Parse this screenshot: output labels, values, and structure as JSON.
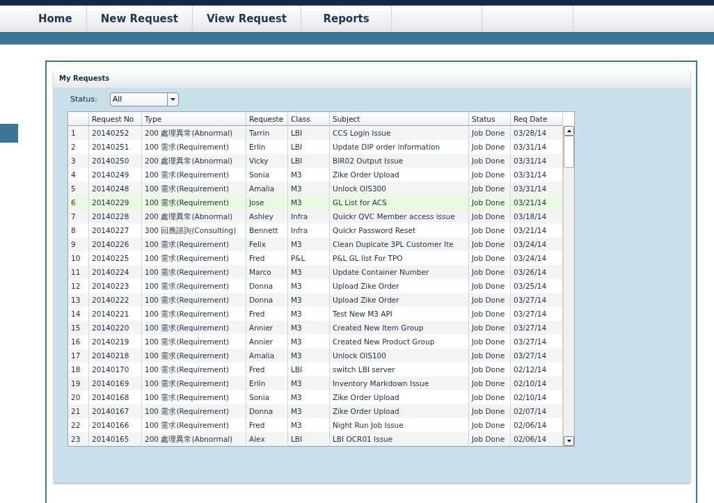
{
  "nav": {
    "tabs": [
      {
        "label": "Home",
        "selected": false
      },
      {
        "label": "New Request",
        "selected": false
      },
      {
        "label": "View Request",
        "selected": false
      },
      {
        "label": "Reports",
        "selected": false
      }
    ]
  },
  "panel": {
    "title": "My Requests",
    "status_filter": {
      "label": "Status:",
      "value": "All"
    }
  },
  "table": {
    "columns": [
      "",
      "Request No",
      "Type",
      "Requeste",
      "Class",
      "Subject",
      "Status",
      "Req Date"
    ],
    "rows": [
      {
        "cells": [
          "1",
          "20140252",
          "200 處理異常(Abnormal)",
          "Tarrin",
          "LBI",
          "CCS Login Issue",
          "Job Done",
          "03/28/14"
        ],
        "selected": false
      },
      {
        "cells": [
          "2",
          "20140251",
          "100 需求(Requirement)",
          "Erlin",
          "LBI",
          "Update DIP order information",
          "Job Done",
          "03/31/14"
        ],
        "selected": false
      },
      {
        "cells": [
          "3",
          "20140250",
          "200 處理異常(Abnormal)",
          "Vicky",
          "LBI",
          "BIR02 Output Issue",
          "Job Done",
          "03/31/14"
        ],
        "selected": false
      },
      {
        "cells": [
          "4",
          "20140249",
          "100 需求(Requirement)",
          "Sonia",
          "M3",
          "Zike Order Upload",
          "Job Done",
          "03/31/14"
        ],
        "selected": false
      },
      {
        "cells": [
          "5",
          "20140248",
          "100 需求(Requirement)",
          "Amalia",
          "M3",
          "Unlock OIS300",
          "Job Done",
          "03/31/14"
        ],
        "selected": false
      },
      {
        "cells": [
          "6",
          "20140229",
          "100 需求(Requirement)",
          "Jose",
          "M3",
          "GL List for ACS",
          "Job Done",
          "03/21/14"
        ],
        "selected": true
      },
      {
        "cells": [
          "7",
          "20140228",
          "200 處理異常(Abnormal)",
          "Ashley",
          "Infra",
          "Quickr QVC Member access issue",
          "Job Done",
          "03/18/14"
        ],
        "selected": false
      },
      {
        "cells": [
          "8",
          "20140227",
          "300 回應諮詢(Consulting)",
          "Bennett",
          "Infra",
          "Quickr Password Reset",
          "Job Done",
          "03/21/14"
        ],
        "selected": false
      },
      {
        "cells": [
          "9",
          "20140226",
          "100 需求(Requirement)",
          "Felix",
          "M3",
          "Clean Duplcate 3PL Customer Ite",
          "Job Done",
          "03/24/14"
        ],
        "selected": false
      },
      {
        "cells": [
          "10",
          "20140225",
          "100 需求(Requirement)",
          "Fred",
          "P&L",
          "P&L GL list For TPO",
          "Job Done",
          "03/24/14"
        ],
        "selected": false
      },
      {
        "cells": [
          "11",
          "20140224",
          "100 需求(Requirement)",
          "Marco",
          "M3",
          "Update Container Number",
          "Job Done",
          "03/26/14"
        ],
        "selected": false
      },
      {
        "cells": [
          "12",
          "20140223",
          "100 需求(Requirement)",
          "Donna",
          "M3",
          "Upload Zike Order",
          "Job Done",
          "03/25/14"
        ],
        "selected": false
      },
      {
        "cells": [
          "13",
          "20140222",
          "100 需求(Requirement)",
          "Donna",
          "M3",
          "Upload Zike Order",
          "Job Done",
          "03/27/14"
        ],
        "selected": false
      },
      {
        "cells": [
          "14",
          "20140221",
          "100 需求(Requirement)",
          "Fred",
          "M3",
          "Test New M3 API",
          "Job Done",
          "03/27/14"
        ],
        "selected": false
      },
      {
        "cells": [
          "15",
          "20140220",
          "100 需求(Requirement)",
          "Annier",
          "M3",
          "Created New Item Group",
          "Job Done",
          "03/27/14"
        ],
        "selected": false
      },
      {
        "cells": [
          "16",
          "20140219",
          "100 需求(Requirement)",
          "Annier",
          "M3",
          "Created New Product Group",
          "Job Done",
          "03/27/14"
        ],
        "selected": false
      },
      {
        "cells": [
          "17",
          "20140218",
          "100 需求(Requirement)",
          "Amalia",
          "M3",
          "Unlock OIS100",
          "Job Done",
          "03/27/14"
        ],
        "selected": false
      },
      {
        "cells": [
          "18",
          "20140170",
          "100 需求(Requirement)",
          "Fred",
          "LBI",
          "switch LBI server",
          "Job Done",
          "02/12/14"
        ],
        "selected": false
      },
      {
        "cells": [
          "19",
          "20140169",
          "100 需求(Requirement)",
          "Erlin",
          "M3",
          "Inventory Markdown Issue",
          "Job Done",
          "02/10/14"
        ],
        "selected": false
      },
      {
        "cells": [
          "20",
          "20140168",
          "100 需求(Requirement)",
          "Sonia",
          "M3",
          "Zike Order Upload",
          "Job Done",
          "02/10/14"
        ],
        "selected": false
      },
      {
        "cells": [
          "21",
          "20140167",
          "100 需求(Requirement)",
          "Donna",
          "M3",
          "Zike Order Upload",
          "Job Done",
          "02/07/14"
        ],
        "selected": false
      },
      {
        "cells": [
          "22",
          "20140166",
          "100 需求(Requirement)",
          "Fred",
          "M3",
          "Night Run Job Issue",
          "Job Done",
          "02/06/14"
        ],
        "selected": false
      },
      {
        "cells": [
          "23",
          "20140165",
          "200 處理異常(Abnormal)",
          "Alex",
          "LBI",
          "LBI OCR01 Issue",
          "Job Done",
          "02/06/14"
        ],
        "selected": false
      }
    ]
  }
}
